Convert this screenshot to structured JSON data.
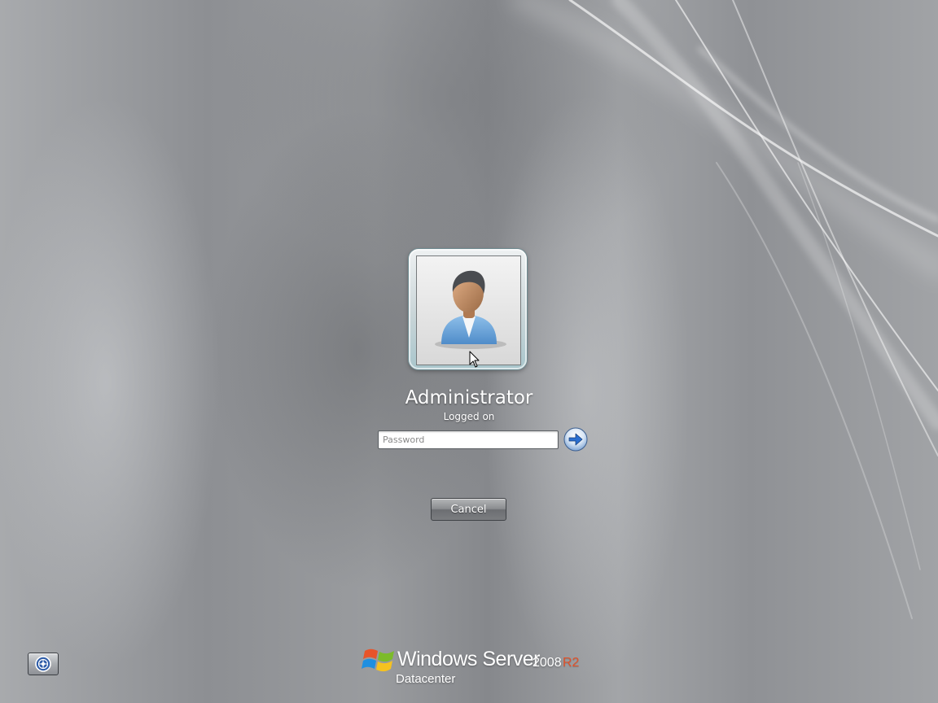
{
  "user": {
    "name": "Administrator",
    "status": "Logged on",
    "avatar_icon": "user-avatar-icon"
  },
  "password": {
    "placeholder": "Password",
    "value": ""
  },
  "submit": {
    "icon": "arrow-right-icon"
  },
  "buttons": {
    "cancel_label": "Cancel",
    "ease_of_access_icon": "ease-of-access-icon"
  },
  "branding": {
    "name": "Windows Server",
    "version": "2008",
    "release": "R2",
    "edition": "Datacenter",
    "logo_icon": "windows-flag-logo"
  },
  "colors": {
    "release_accent": "#e0522a",
    "arrow_button": "#2a6fd1"
  }
}
